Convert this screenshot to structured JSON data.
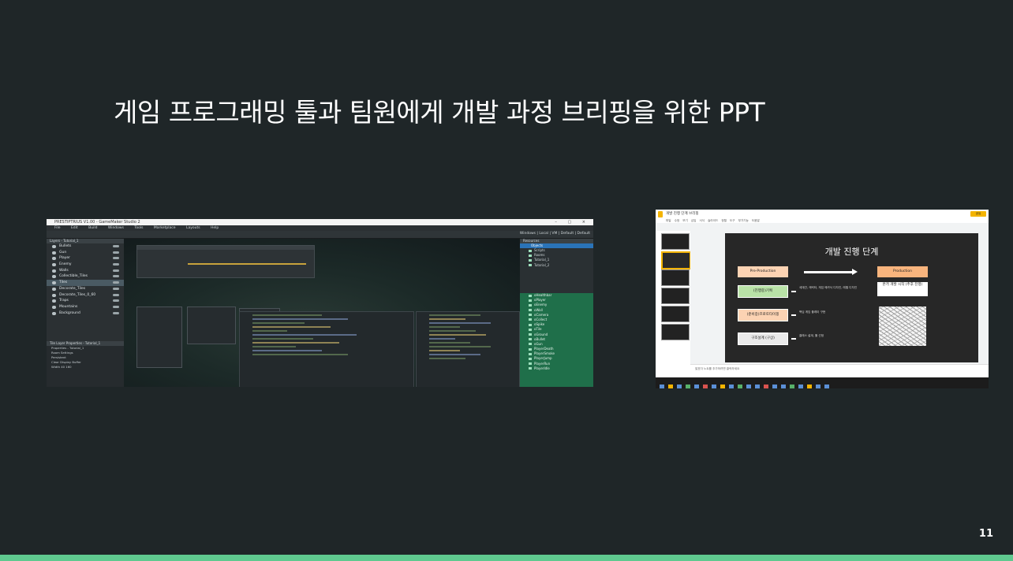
{
  "slide": {
    "title": "게임 프로그래밍 툴과 팀원에게 개발 과정 브리핑을 위한 PPT",
    "page_number": "11",
    "accent_color": "#5fc98f",
    "background_color": "#1f2628"
  },
  "gamemaker": {
    "window_title": "PRESTIPTRIUS V1.00 - GameMaker Studio 2",
    "menu": [
      "File",
      "Edit",
      "Build",
      "Windows",
      "Tools",
      "Marketplace",
      "Layouts",
      "Help"
    ],
    "toolbar_right": "Windows | Local | VM | Default | Default",
    "layers_header": "Layers - Tutorial_1",
    "layers": [
      "Bullets",
      "Gun",
      "Player",
      "Enemy",
      "Walls",
      "Collectible_Tiles",
      "Tiles",
      "Decorate_Tiles",
      "Decorate_Tiles_0_60",
      "Traps",
      "Mountains",
      "Background"
    ],
    "selected_layer": "Tiles",
    "properties_header": "Tile Layer Properties - Tutorial_1",
    "properties": [
      "Properties - Tutorial_1",
      "Room Settings",
      "Persistent",
      "Clear Display Buffer",
      "Width"
    ],
    "width_value": "40 160",
    "resources_header": "Resources",
    "resources_selected": "Objects",
    "resource_groups": [
      "Scripts",
      "Rooms",
      "Tutorial_1",
      "Tutorial_2"
    ],
    "objects": [
      "oHealthbar",
      "oPlayer",
      "oEnemy",
      "oWall",
      "oCamera",
      "oCollect",
      "oSpike",
      "oTile",
      "oGround",
      "oBullet",
      "oGun",
      "PlayerDeath",
      "PlayerSmoke",
      "PlayerJump",
      "PlayerRun",
      "PlayerIdle"
    ]
  },
  "slides_app": {
    "doc_title": "개발 진행 단계 브리핑",
    "share_label": "공유",
    "menus": [
      "파일",
      "수정",
      "보기",
      "삽입",
      "서식",
      "슬라이드",
      "정렬",
      "도구",
      "부가기능",
      "도움말"
    ],
    "slide_title": "개발 진행 단계",
    "pre_production": "Pre-Production",
    "production": "Production",
    "step1": "(진행중)기획",
    "step2": "(준비중)프로토타이핑",
    "step3": "구조설계 (구상)",
    "note1": "세계관, 캐릭터, 게임 메카닉 디자인, 레벨 디자인",
    "note2": "핵심 게임 플레이 구현",
    "note3": "클래스 설계, 툴 선정",
    "prod_box": "본격 개발 시작 (추후 진행)",
    "speaker_notes": "발표자 노트를 추가하려면 클릭하세요"
  }
}
